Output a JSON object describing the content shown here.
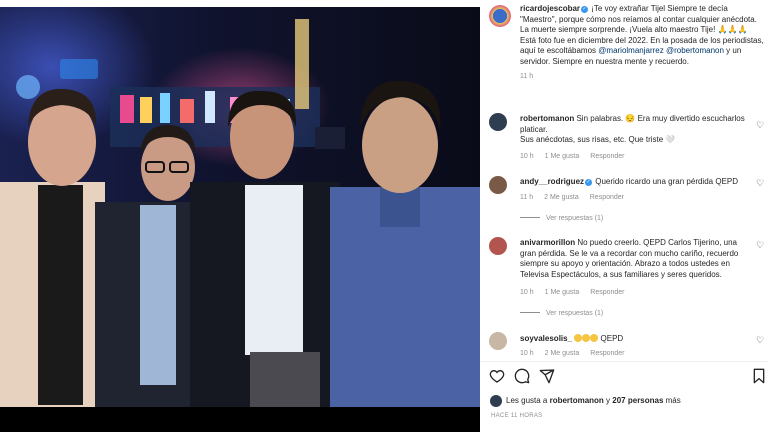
{
  "post": {
    "author": "ricardojescobar",
    "caption": "¡Te voy extrañar Tijel Siempre te decía \"Maestro\", porque cómo nos reíamos al contar cualquier anécdota. La muerte siempre sorprende. ¡Vuela alto maestro Tije! 🙏🙏🙏 Está foto fue en diciembre del 2022. En la posada de los periodistas, aquí te escoltábamos ",
    "mention1": "@mariolmanjarrez",
    "mention2": "@robertomanon",
    "caption_end": " y un servidor. Siempre en nuestra mente y recuerdo.",
    "time": "11 h"
  },
  "comments": [
    {
      "user": "robertomanon",
      "text": "Sin palabras. 😔 Era muy divertido escucharlos platicar.",
      "text2": "Sus anécdotas, sus risas, etc. Que triste 🤍",
      "time": "10 h",
      "likes": "1 Me gusta",
      "reply": "Responder"
    },
    {
      "user": "andy__rodriguez",
      "text": "Querido ricardo una gran pérdida QEPD",
      "time": "11 h",
      "likes": "2 Me gusta",
      "reply": "Responder",
      "view_replies": "Ver respuestas (1)"
    },
    {
      "user": "anivarmorillon",
      "text": "No puedo creerlo. QEPD Carlos Tijerino, una gran pérdida. Se le va a recordar con mucho cariño, recuerdo siempre su apoyo y orientación. Abrazo a todos ustedes en Televisa Espectáculos, a sus familiares y seres queridos.",
      "time": "10 h",
      "likes": "1 Me gusta",
      "reply": "Responder",
      "view_replies": "Ver respuestas (1)"
    },
    {
      "user": "soyvalesolis_",
      "text": "QEPD",
      "time": "10 h",
      "likes": "2 Me gusta",
      "reply": "Responder"
    }
  ],
  "likes": {
    "prefix": "Les gusta a ",
    "user": "robertomanon",
    "middle": " y ",
    "count": "207 personas",
    "suffix": " más"
  },
  "post_time": "HACE 11 HORAS",
  "icons": {
    "like": "heart-icon",
    "comment": "comment-icon",
    "share": "share-icon",
    "save": "bookmark-icon",
    "verified": "verified-badge-icon"
  },
  "colors": {
    "link": "#00376b",
    "muted": "#8e8e8e",
    "verified": "#3897f0"
  }
}
